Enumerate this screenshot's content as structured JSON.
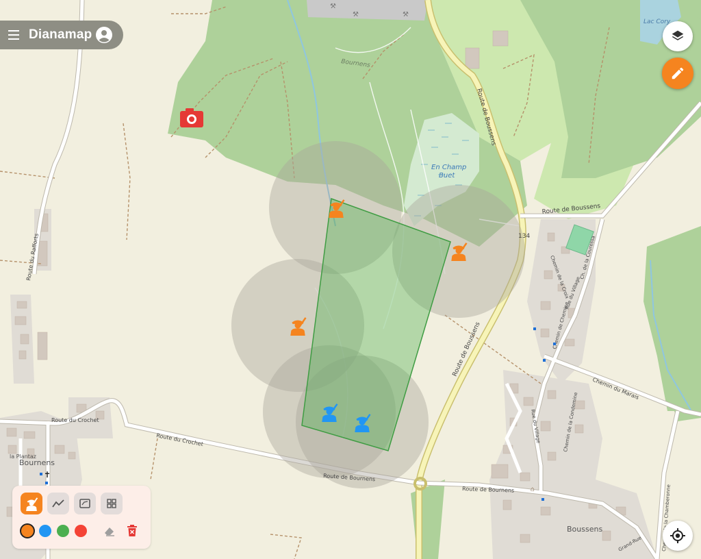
{
  "app": {
    "title": "Dianamap"
  },
  "map_labels": {
    "forest": "Bournens",
    "lac": "Lac Cory",
    "champ": [
      "En Champ",
      "Buet"
    ],
    "route_boussens_1": "Route de Boussens",
    "route_boussens_2": "Route de Boussens",
    "route_boussens_3": "Route de Boussens",
    "road_number": "134",
    "route_rafforts": "Route du Rafforts",
    "route_crochet_1": "Route du Crochet",
    "route_crochet_2": "Route du Crochet",
    "route_bournens_1": "Route de Bournens",
    "route_bournens_2": "Route de Bournens",
    "chemin_marais": "Chemin du Marais",
    "village_bournens": "Bournens",
    "village_boussens": "Boussens",
    "plantaz": "la Plantaz",
    "chemin_croix": "Chemin de la Croix",
    "rue_village_1": "Rue du Village",
    "rue_village_2": "Rue du Village",
    "chemin_chemine": "Chemin de Chemine",
    "chemin_condemine": "Chemin de la Condemine",
    "chemin_chamberonne": "Chemin de la Chamberonne",
    "chemin_couressa": "Ch. de la Couressa",
    "grand_rue": "Grand-Rue"
  },
  "hunters": [
    {
      "color": "orange",
      "name": "hunter-orange"
    },
    {
      "color": "orange",
      "name": "hunter-orange"
    },
    {
      "color": "orange",
      "name": "hunter-orange"
    },
    {
      "color": "blue",
      "name": "hunter-blue"
    },
    {
      "color": "blue",
      "name": "hunter-blue"
    }
  ],
  "toolbox": {
    "tools": [
      {
        "name": "hunter-tool",
        "icon": "hunter-icon",
        "active": true
      },
      {
        "name": "line-tool",
        "icon": "polyline-icon",
        "active": false
      },
      {
        "name": "area-tool",
        "icon": "polygon-icon",
        "active": false
      },
      {
        "name": "grid-tool",
        "icon": "grid-icon",
        "active": false
      }
    ],
    "colors": [
      {
        "name": "orange",
        "hex": "#f5841f",
        "selected": true
      },
      {
        "name": "blue",
        "hex": "#2196f3",
        "selected": false
      },
      {
        "name": "green",
        "hex": "#4caf50",
        "selected": false
      },
      {
        "name": "red",
        "hex": "#f44336",
        "selected": false
      }
    ],
    "actions": [
      "eraser-icon",
      "delete-icon"
    ]
  },
  "icons": {
    "menu": "menu-icon",
    "account": "account-icon",
    "layers": "layers-icon",
    "edit": "pencil-icon",
    "locate": "locate-icon",
    "camera": "camera-icon"
  },
  "colors": {
    "accent": "#f5841f",
    "hunter_orange": "#f5841f",
    "hunter_blue": "#2196f3",
    "polygon": "#4caf50",
    "forest": "#aed19a",
    "background": "#f2efdf",
    "marker_red": "#e53935"
  }
}
